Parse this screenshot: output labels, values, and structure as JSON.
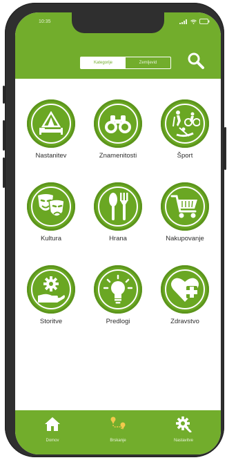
{
  "status": {
    "time": "10:35"
  },
  "header": {
    "segments": [
      {
        "label": "Kategorije",
        "active": true
      },
      {
        "label": "Zemljevid",
        "active": false
      }
    ],
    "search_icon": "search-icon"
  },
  "categories": [
    {
      "label": "Nastanitev",
      "icon": "tent-bed-icon"
    },
    {
      "label": "Znamenitosti",
      "icon": "binoculars-icon"
    },
    {
      "label": "Šport",
      "icon": "sports-icon"
    },
    {
      "label": "Kultura",
      "icon": "theater-masks-icon"
    },
    {
      "label": "Hrana",
      "icon": "fork-knife-icon"
    },
    {
      "label": "Nakupovanje",
      "icon": "shopping-cart-icon"
    },
    {
      "label": "Storitve",
      "icon": "gear-hand-icon"
    },
    {
      "label": "Predlogi",
      "icon": "lightbulb-icon"
    },
    {
      "label": "Zdravstvo",
      "icon": "heart-plus-icon"
    }
  ],
  "tabbar": {
    "items": [
      {
        "label": "Domov",
        "icon": "home-icon"
      },
      {
        "label": "Brskanje",
        "icon": "route-pin-icon"
      },
      {
        "label": "Nastavitve",
        "icon": "settings-search-icon"
      }
    ]
  },
  "colors": {
    "brand": "#72ad2c",
    "icon_fill": "#6aa723",
    "route_pin": "#f2c94c"
  }
}
